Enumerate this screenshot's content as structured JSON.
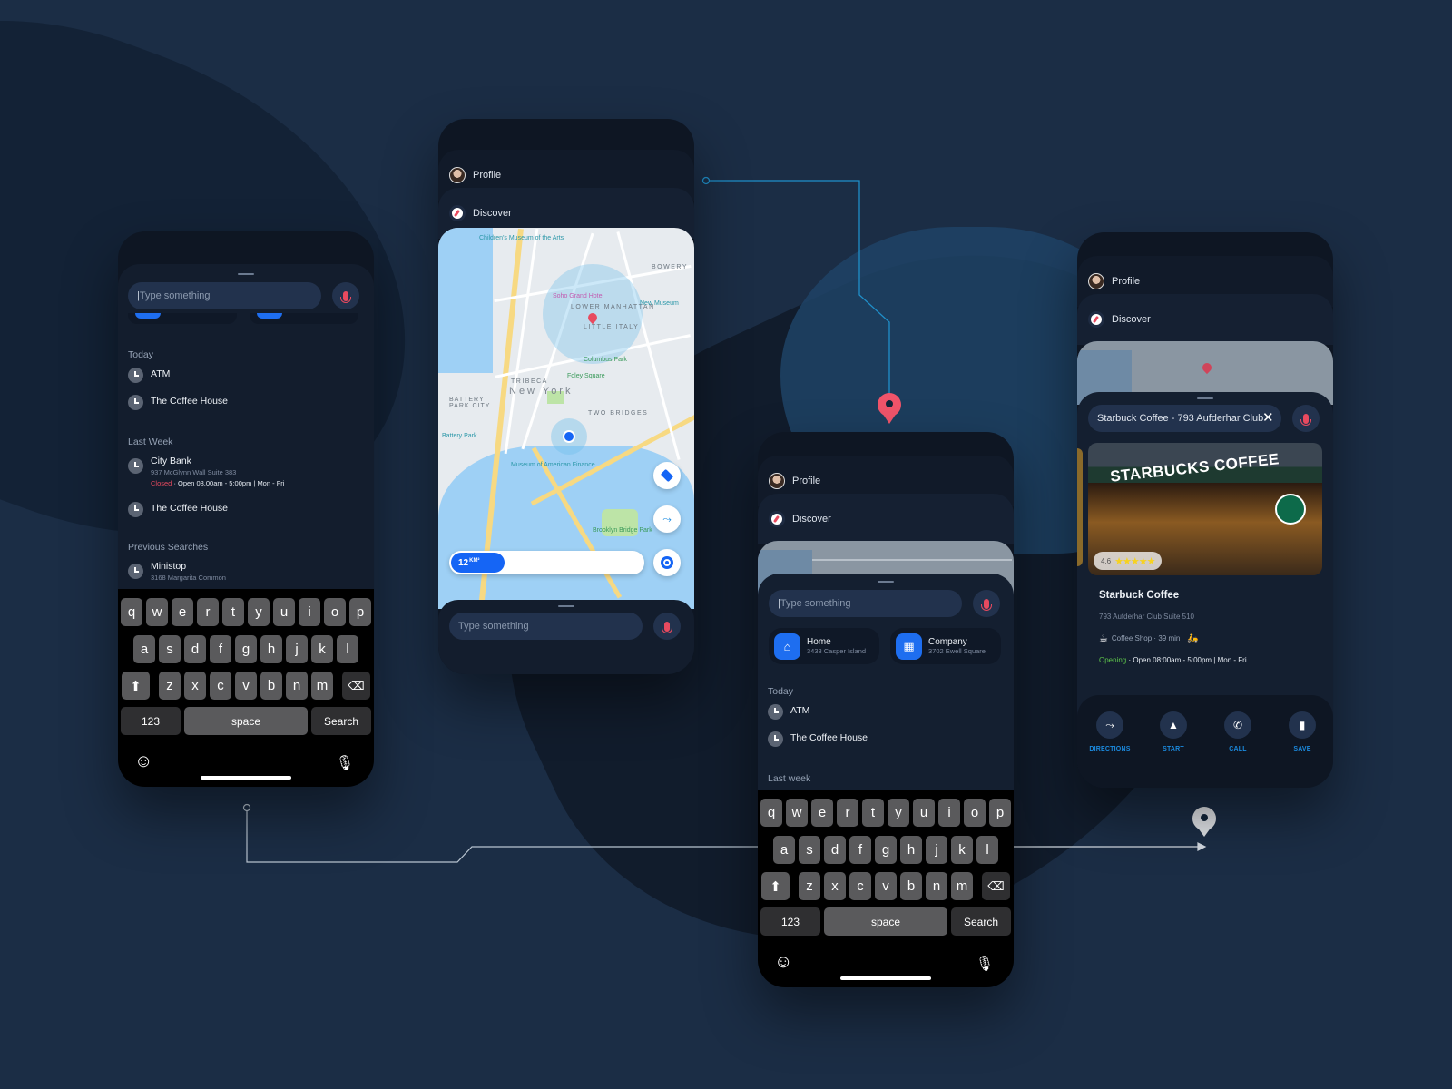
{
  "common": {
    "profile_label": "Profile",
    "discover_label": "Discover",
    "search_placeholder": "Type something"
  },
  "screen_history": {
    "sections": {
      "today": "Today",
      "last_week": "Last Week",
      "previous": "Previous Searches"
    },
    "today": [
      {
        "title": "ATM"
      },
      {
        "title": "The Coffee House"
      }
    ],
    "last_week": [
      {
        "title": "City Bank",
        "address": "937 McGlynn Wall Suite 383",
        "status": "Closed",
        "hours": " · Open 08.00am - 5:00pm | Mon - Fri"
      },
      {
        "title": "The Coffee House"
      }
    ],
    "previous": [
      {
        "title": "Ministop",
        "address": "3168 Margarita Common"
      }
    ]
  },
  "keyboard": {
    "row1": [
      "q",
      "w",
      "e",
      "r",
      "t",
      "y",
      "u",
      "i",
      "o",
      "p"
    ],
    "row2": [
      "a",
      "s",
      "d",
      "f",
      "g",
      "h",
      "j",
      "k",
      "l"
    ],
    "row3": [
      "z",
      "x",
      "c",
      "v",
      "b",
      "n",
      "m"
    ],
    "numbers": "123",
    "space": "space",
    "search": "Search"
  },
  "screen_map": {
    "map_labels": {
      "neighborhood_1": "LOWER MANHATTAN",
      "neighborhood_2": "LITTLE ITALY",
      "neighborhood_3": "TRIBECA",
      "neighborhood_4": "BOWERY",
      "neighborhood_5": "TWO BRIDGES",
      "neighborhood_6": "BATTERY PARK CITY",
      "city": "New York",
      "poi_1": "Columbus Park",
      "poi_2": "Foley Square",
      "poi_3": "Soho Grand Hotel",
      "poi_4": "New Museum",
      "poi_5": "Museum of American Finance",
      "poi_6": "Brooklyn Bridge Park",
      "poi_7": "Children's Museum of the Arts",
      "poi_8": "Battery Park"
    },
    "radius_label": "12",
    "radius_unit": "KM²",
    "radius_fraction": 0.28
  },
  "screen_favorites": {
    "favorites": [
      {
        "title": "Home",
        "address": "3438 Casper Island"
      },
      {
        "title": "Company",
        "address": "3702 Ewell Square"
      }
    ],
    "sections": {
      "today": "Today",
      "last_week": "Last week"
    },
    "today": [
      {
        "title": "ATM"
      },
      {
        "title": "The Coffee House"
      }
    ]
  },
  "screen_place": {
    "search_value": "Starbuck Coffee - 793 Aufderhar Club",
    "photo_sign": "STARBUCKS COFFEE",
    "rating": "4.6",
    "rating_value": 4.6,
    "name": "Starbuck Coffee",
    "address": "793 Aufderhar Club Suite 510",
    "category": "Coffee Shop · 39 min",
    "status": "Opening",
    "hours": " · Open 08:00am - 5:00pm | Mon - Fri",
    "actions": [
      {
        "label": "DIRECTIONS"
      },
      {
        "label": "START"
      },
      {
        "label": "CALL"
      },
      {
        "label": "SAVE"
      }
    ]
  },
  "colors": {
    "background": "#1b2d45",
    "accent_blue": "#1565f5",
    "action_label": "#1b8be0",
    "closed_red": "#e84a5f",
    "open_green": "#5fc84b",
    "connector_cyan": "#1f8fc9"
  }
}
